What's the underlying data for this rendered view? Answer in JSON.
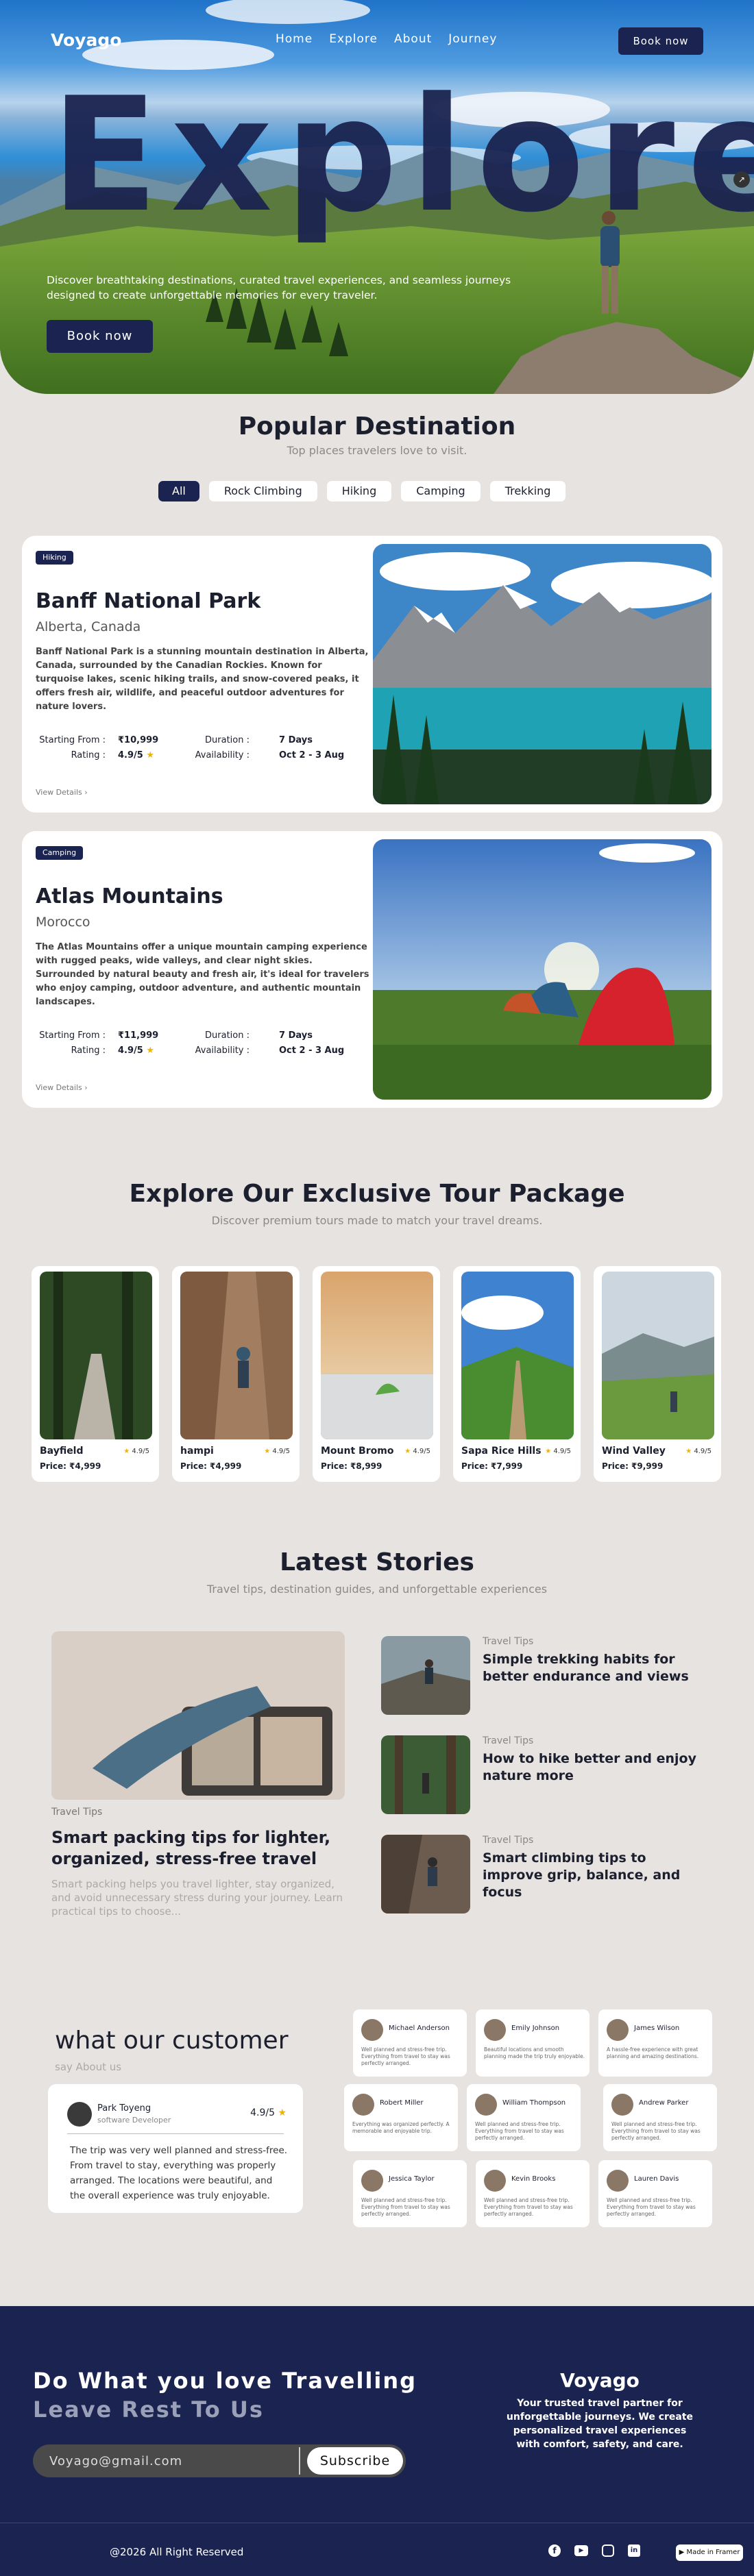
{
  "nav": {
    "logo": "Voyago",
    "links": [
      "Home",
      "Explore",
      "About",
      "Journey"
    ],
    "book_label": "Book now"
  },
  "hero": {
    "title": "Explore",
    "description": "Discover breathtaking destinations, curated travel experiences, and seamless journeys designed to create unforgettable memories for every traveler.",
    "button": "Book now"
  },
  "popular": {
    "title": "Popular Destination",
    "subtitle": "Top places travelers love to visit.",
    "filters": [
      "All",
      "Rock Climbing",
      "Hiking",
      "Camping",
      "Trekking"
    ],
    "cards": [
      {
        "tag": "Hiking",
        "name": "Banff National Park",
        "location": "Alberta, Canada",
        "description": "Banff National Park is a stunning mountain destination in Alberta, Canada, surrounded by the Canadian Rockies. Known for turquoise lakes, scenic hiking trails, and snow-covered peaks, it offers fresh air, wildlife, and peaceful outdoor adventures for nature lovers.",
        "starting_label": "Starting  From :",
        "starting": "₹10,999",
        "duration_label": "Duration :",
        "duration": "7 Days",
        "rating_label": "Rating :",
        "rating": "4.9/5",
        "availability_label": "Availability :",
        "availability": "Oct 2 - 3 Aug",
        "more": "View Details"
      },
      {
        "tag": "Camping",
        "name": "Atlas Mountains",
        "location": "Morocco",
        "description": "The Atlas Mountains offer a unique mountain camping experience with rugged peaks, wide valleys, and clear night skies. Surrounded by natural beauty and fresh air, it's ideal for travelers who enjoy camping, outdoor adventure, and authentic mountain landscapes.",
        "starting_label": "Starting  From :",
        "starting": "₹11,999",
        "duration_label": "Duration :",
        "duration": "7 Days",
        "rating_label": "Rating :",
        "rating": "4.9/5",
        "availability_label": "Availability :",
        "availability": "Oct 2 - 3 Aug",
        "more": "View Details"
      }
    ]
  },
  "tours": {
    "title": "Explore Our Exclusive Tour Package",
    "subtitle": "Discover premium tours made to match your travel dreams.",
    "items": [
      {
        "name": "Bayfield",
        "rating": "4.9/5",
        "price": "Price: ₹4,999"
      },
      {
        "name": "hampi",
        "rating": "4.9/5",
        "price": "Price: ₹4,999"
      },
      {
        "name": "Mount Bromo",
        "rating": "4.9/5",
        "price": "Price: ₹8,999"
      },
      {
        "name": "Sapa Rice Hills",
        "rating": "4.9/5",
        "price": "Price: ₹7,999"
      },
      {
        "name": "Wind Valley",
        "rating": "4.9/5",
        "price": "Price: ₹9,999"
      }
    ]
  },
  "stories": {
    "title": "Latest Stories",
    "subtitle": "Travel tips, destination guides, and unforgettable experiences",
    "main": {
      "category": "Travel Tips",
      "title": "Smart packing tips for lighter, organized, stress-free travel",
      "excerpt": "Smart packing helps you travel lighter, stay organized, and avoid unnecessary stress during your journey. Learn practical tips to choose..."
    },
    "side": [
      {
        "category": "Travel Tips",
        "title": "Simple trekking habits for better endurance and views"
      },
      {
        "category": "Travel Tips",
        "title": "How to hike better and enjoy nature more"
      },
      {
        "category": "Travel Tips",
        "title": "Smart climbing tips to improve grip, balance, and focus"
      }
    ]
  },
  "testimonials": {
    "title": "what our customer",
    "subtitle": "say About us",
    "featured": {
      "name": "Park Toyeng",
      "role": "software Developer",
      "rating": "4.9/5",
      "text": "The trip was very well planned and stress-free. From travel to stay, everything was properly arranged. The locations were beautiful, and the overall experience was truly enjoyable."
    },
    "cards": [
      {
        "name": "Michael Anderson",
        "text": "Well planned and stress-free trip. Everything from travel to stay was perfectly arranged."
      },
      {
        "name": "Emily Johnson",
        "text": "Beautiful locations and smooth planning made the trip truly enjoyable."
      },
      {
        "name": "James Wilson",
        "text": "A hassle-free experience with great planning and amazing destinations."
      },
      {
        "name": "Robert Miller",
        "text": "Everything was organized perfectly. A memorable and enjoyable trip."
      },
      {
        "name": "William Thompson",
        "text": "Well planned and stress-free trip. Everything from travel to stay was perfectly arranged."
      },
      {
        "name": "Andrew Parker",
        "text": "Well planned and stress-free trip. Everything from travel to stay was perfectly arranged."
      },
      {
        "name": "Jessica Taylor",
        "text": "Well planned and stress-free trip. Everything from travel to stay was perfectly arranged."
      },
      {
        "name": "Kevin Brooks",
        "text": "Well planned and stress-free trip. Everything from travel to stay was perfectly arranged."
      },
      {
        "name": "Lauren Davis",
        "text": "Well planned and stress-free trip. Everything from travel to stay was perfectly arranged."
      }
    ]
  },
  "footer": {
    "headline1": "Do What you love Travelling",
    "headline2": "Leave Rest To Us",
    "email_value": "Voyago@gmail.com",
    "subscribe": "Subscribe",
    "brand": "Voyago",
    "brand_text": "Your trusted travel partner for unforgettable journeys. We create personalized travel experiences with comfort, safety, and care.",
    "copyright": "@2026 All Right Reserved",
    "socials": [
      "facebook-icon",
      "youtube-icon",
      "instagram-icon",
      "linkedin-icon"
    ],
    "badge": "Made in Framer"
  },
  "colors": {
    "navy": "#1b2450",
    "bg": "#e7e3e1",
    "star": "#f0b400"
  }
}
